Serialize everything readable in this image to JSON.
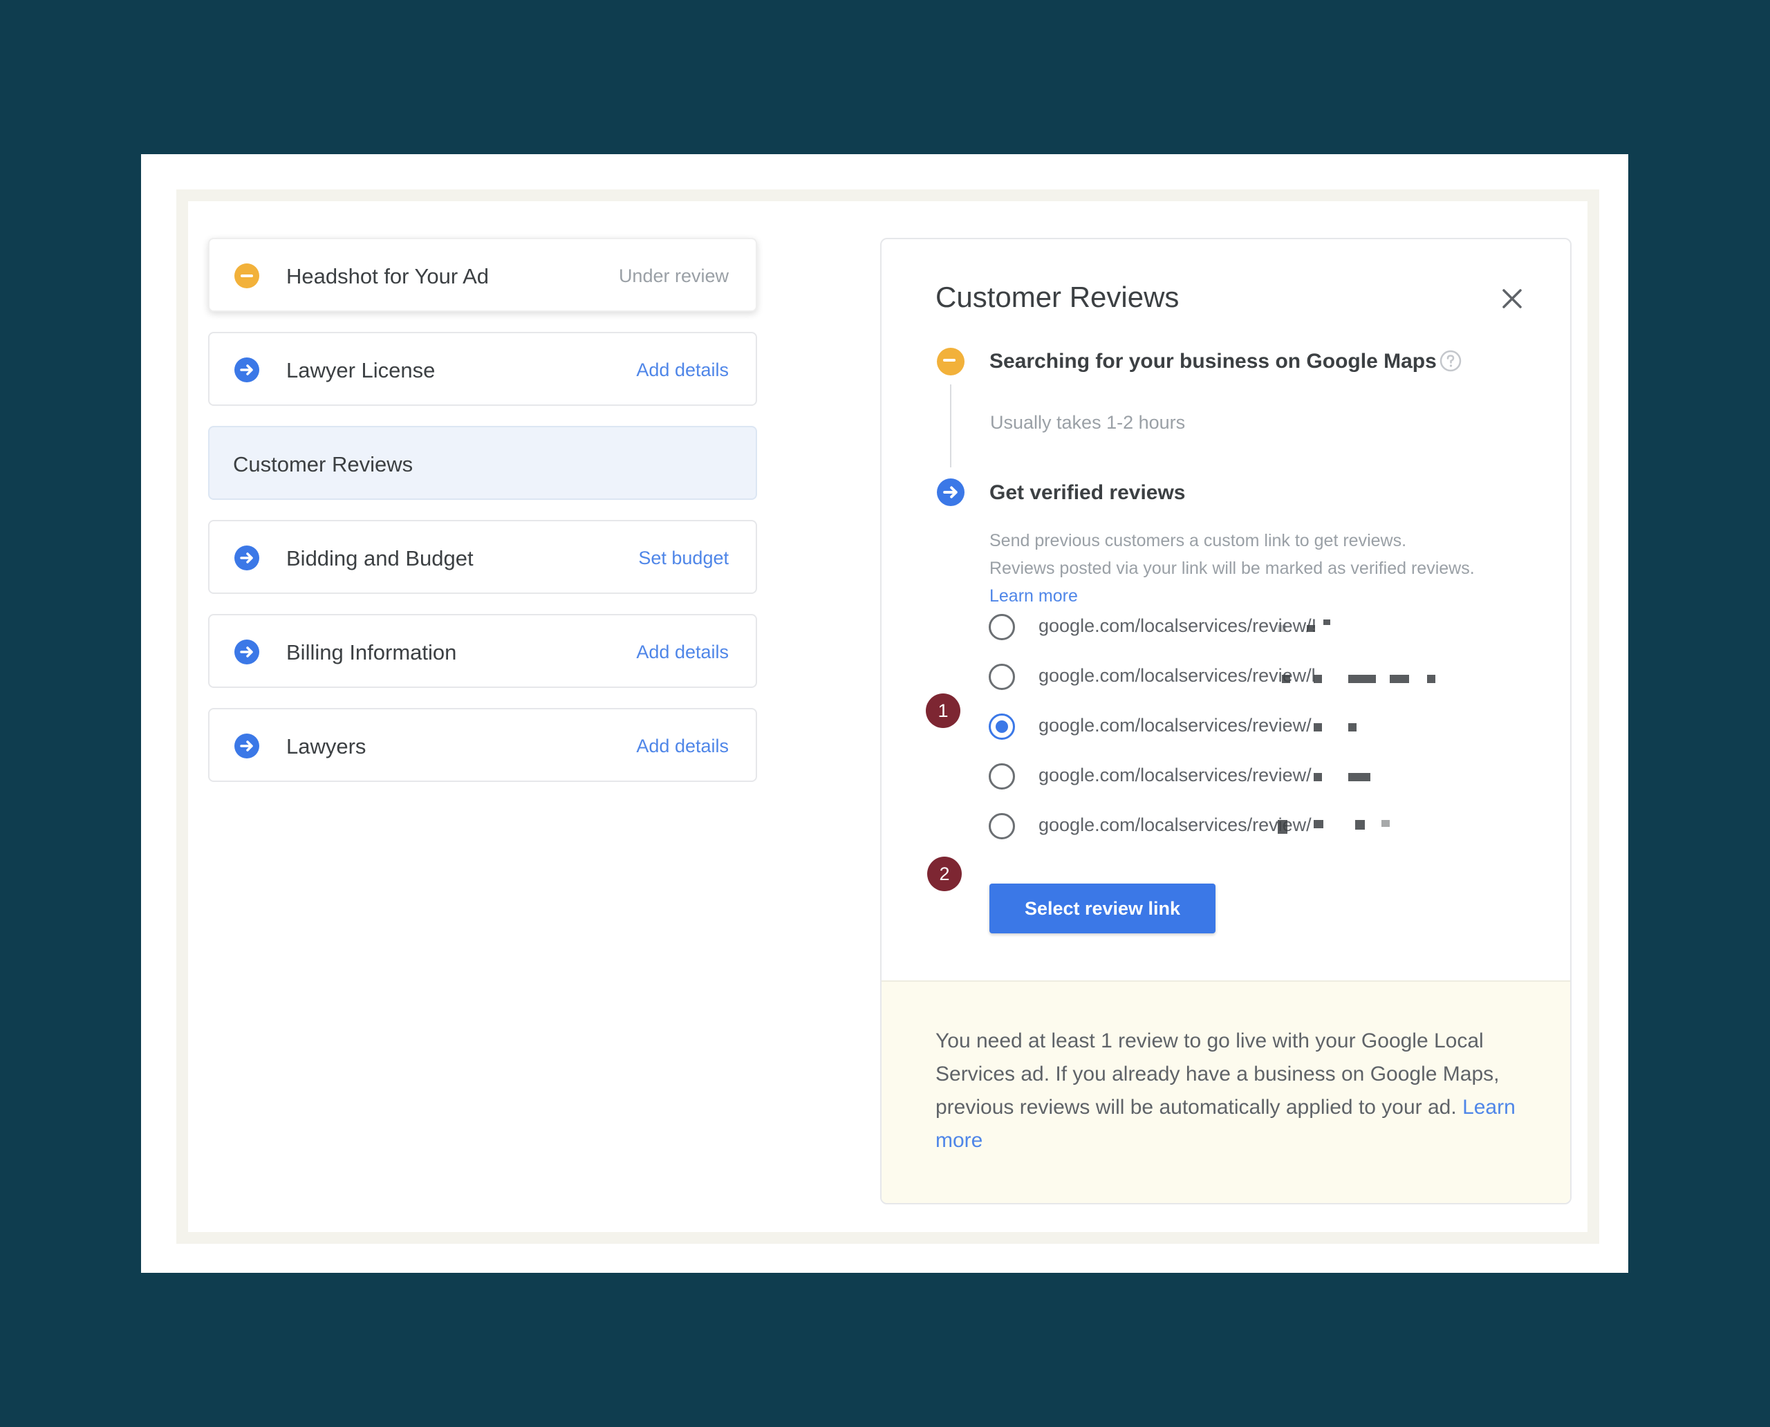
{
  "steps": [
    {
      "label": "Headshot for Your Ad",
      "action": "Under review",
      "status": "pending"
    },
    {
      "label": "Lawyer License",
      "action": "Add details",
      "status": "todo"
    },
    {
      "label": "Customer Reviews",
      "action": "",
      "status": "active"
    },
    {
      "label": "Bidding and Budget",
      "action": "Set budget",
      "status": "todo"
    },
    {
      "label": "Billing Information",
      "action": "Add details",
      "status": "todo"
    },
    {
      "label": "Lawyers",
      "action": "Add details",
      "status": "todo"
    }
  ],
  "panel": {
    "title": "Customer Reviews",
    "section1": {
      "title": "Searching for your business on Google Maps",
      "note": "Usually takes 1-2 hours"
    },
    "section2": {
      "title": "Get verified reviews",
      "desc_line1": "Send previous customers a custom link to get reviews.",
      "desc_line2": "Reviews posted via your link will be marked as verified reviews.",
      "learn_more": "Learn more"
    },
    "options": [
      {
        "text": "google.com/localservices/review/!",
        "checked": false
      },
      {
        "text": "google.com/localservices/review/l",
        "checked": false
      },
      {
        "text": "google.com/localservices/review/",
        "checked": true
      },
      {
        "text": "google.com/localservices/review/",
        "checked": false
      },
      {
        "text": "google.com/localservices/review/",
        "checked": false
      }
    ],
    "badge1": "1",
    "badge2": "2",
    "select_button": "Select review link",
    "info": {
      "text": "You need at least 1 review to go live with your Google Local Services ad. If you already have a business on Google Maps, previous reviews will be automatically applied to your ad.",
      "learn_more": "Learn more"
    }
  },
  "colors": {
    "background": "#0f3d4f",
    "accent": "#3b78e7",
    "pending": "#f2b13a",
    "badge": "#7d2632"
  }
}
